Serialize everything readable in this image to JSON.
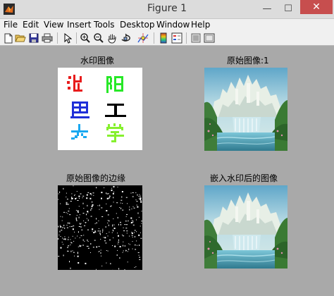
{
  "window": {
    "title": "Figure 1",
    "minimize": "—",
    "maximize": "☐",
    "close": "✕"
  },
  "menu": [
    "File",
    "Edit",
    "View",
    "Insert",
    "Tools",
    "Desktop",
    "Window",
    "Help"
  ],
  "toolbar": {
    "icons": [
      "new-figure-icon",
      "open-file-icon",
      "save-icon",
      "print-icon",
      "pointer-icon",
      "zoom-in-icon",
      "zoom-out-icon",
      "pan-hand-icon",
      "rotate-3d-icon",
      "data-cursor-icon",
      "colorbar-icon",
      "legend-icon",
      "hide-plot-tools-icon",
      "show-plot-tools-icon"
    ]
  },
  "plots": {
    "watermark": {
      "title": "水印图像",
      "chars": [
        "沈",
        "阳",
        "工",
        "大",
        "学",
        "理"
      ]
    },
    "original": {
      "title": "原始图像:1"
    },
    "edges": {
      "title": "原始图像的边缘"
    },
    "embedded": {
      "title": "嵌入水印后的图像"
    }
  },
  "colors": {
    "figure_bg": "#a9a9a9",
    "watermark_red": "#e81c1c",
    "watermark_green": "#27e827",
    "watermark_blue": "#1f2fd8",
    "watermark_black": "#000000",
    "watermark_skyblue": "#19a8f0",
    "watermark_lime": "#86f02e"
  }
}
